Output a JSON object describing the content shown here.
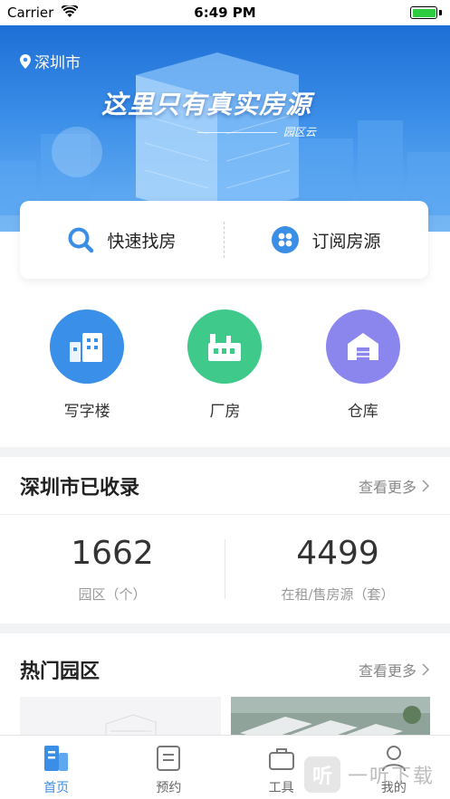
{
  "status_bar": {
    "carrier": "Carrier",
    "time": "6:49 PM"
  },
  "banner": {
    "city": "深圳市",
    "slogan": "这里只有真实房源",
    "brand": "园区云"
  },
  "search": {
    "quick_find": "快速找房",
    "subscribe": "订阅房源"
  },
  "categories": [
    {
      "label": "写字楼",
      "icon": "office-building-icon",
      "color": "#3a8fe8"
    },
    {
      "label": "厂房",
      "icon": "factory-icon",
      "color": "#3fc98a"
    },
    {
      "label": "仓库",
      "icon": "warehouse-icon",
      "color": "#8b86ee"
    }
  ],
  "stats": {
    "title": "深圳市已收录",
    "more": "查看更多",
    "items": [
      {
        "value": "1662",
        "label": "园区（个）"
      },
      {
        "value": "4499",
        "label": "在租/售房源（套）"
      }
    ]
  },
  "hot": {
    "title": "热门园区",
    "more": "查看更多"
  },
  "tabs": [
    {
      "label": "首页",
      "icon": "home-icon",
      "active": true
    },
    {
      "label": "预约",
      "icon": "appointment-icon",
      "active": false
    },
    {
      "label": "工具",
      "icon": "toolbox-icon",
      "active": false
    },
    {
      "label": "我的",
      "icon": "profile-icon",
      "active": false
    }
  ],
  "watermark": {
    "badge": "听",
    "text": "一听下载"
  },
  "colors": {
    "accent": "#3a8ee6",
    "banner_top": "#1e6fd6",
    "banner_bottom": "#6db3f5"
  }
}
